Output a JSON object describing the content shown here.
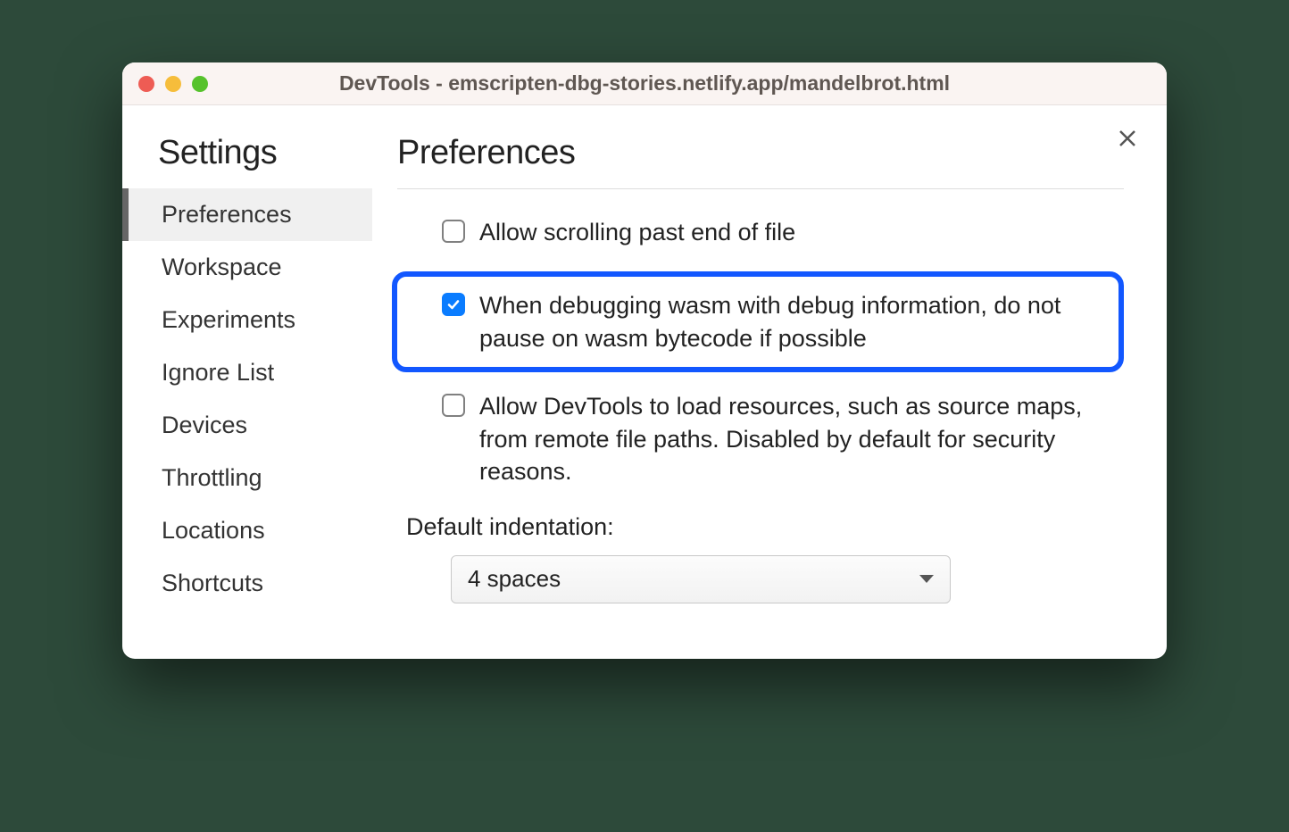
{
  "window": {
    "title": "DevTools - emscripten-dbg-stories.netlify.app/mandelbrot.html"
  },
  "sidebar": {
    "heading": "Settings",
    "items": [
      {
        "label": "Preferences",
        "active": true
      },
      {
        "label": "Workspace",
        "active": false
      },
      {
        "label": "Experiments",
        "active": false
      },
      {
        "label": "Ignore List",
        "active": false
      },
      {
        "label": "Devices",
        "active": false
      },
      {
        "label": "Throttling",
        "active": false
      },
      {
        "label": "Locations",
        "active": false
      },
      {
        "label": "Shortcuts",
        "active": false
      }
    ]
  },
  "content": {
    "heading": "Preferences",
    "options": [
      {
        "label": "Allow scrolling past end of file",
        "checked": false,
        "highlight": false
      },
      {
        "label": "When debugging wasm with debug information, do not pause on wasm bytecode if possible",
        "checked": true,
        "highlight": true
      },
      {
        "label": "Allow DevTools to load resources, such as source maps, from remote file paths. Disabled by default for security reasons.",
        "checked": false,
        "highlight": false
      }
    ],
    "indentation": {
      "label": "Default indentation:",
      "value": "4 spaces"
    }
  }
}
